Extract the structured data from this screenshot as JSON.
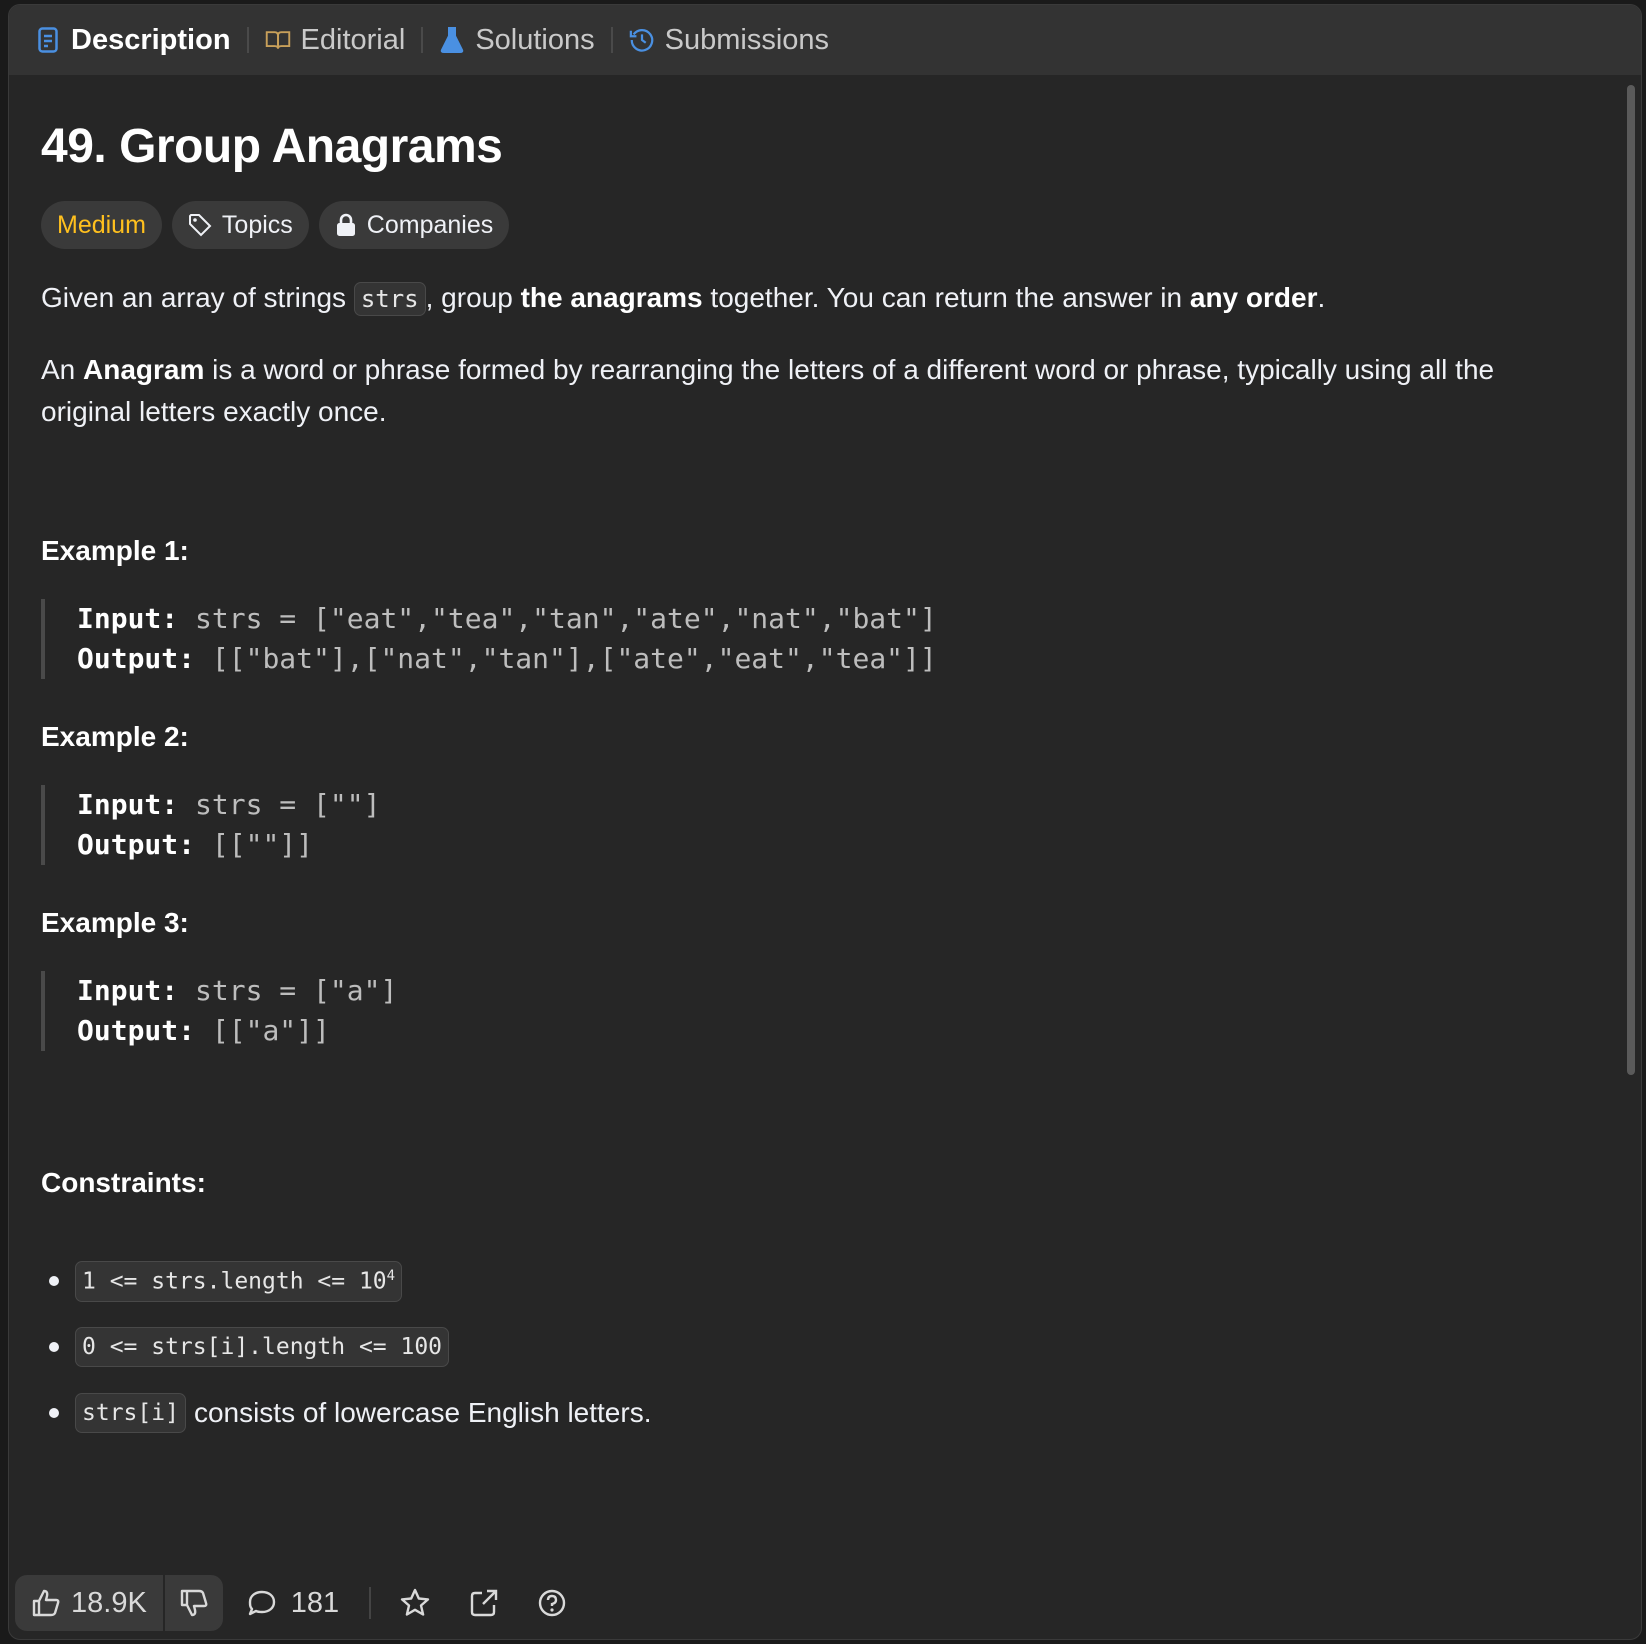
{
  "tabs": [
    {
      "label": "Description",
      "icon": "document-icon",
      "color": "#4a90e2"
    },
    {
      "label": "Editorial",
      "icon": "book-icon",
      "color": "#c8a05a"
    },
    {
      "label": "Solutions",
      "icon": "flask-icon",
      "color": "#4a90e2"
    },
    {
      "label": "Submissions",
      "icon": "history-icon",
      "color": "#4a90e2"
    }
  ],
  "problem": {
    "title": "49. Group Anagrams",
    "difficulty": "Medium",
    "topics_label": "Topics",
    "companies_label": "Companies",
    "p1": {
      "t1": "Given an array of strings ",
      "code": "strs",
      "t2": ", group ",
      "b1": "the anagrams",
      "t3": " together. You can return the answer in ",
      "b2": "any order",
      "t4": "."
    },
    "p2": {
      "t1": "An ",
      "b1": "Anagram",
      "t2": " is a word or phrase formed by rearranging the letters of a different word or phrase, typically using all the original letters exactly once."
    }
  },
  "examples": [
    {
      "title": "Example 1:",
      "input_label": "Input:",
      "input": " strs = [\"eat\",\"tea\",\"tan\",\"ate\",\"nat\",\"bat\"]",
      "output_label": "Output:",
      "output": " [[\"bat\"],[\"nat\",\"tan\"],[\"ate\",\"eat\",\"tea\"]]"
    },
    {
      "title": "Example 2:",
      "input_label": "Input:",
      "input": " strs = [\"\"]",
      "output_label": "Output:",
      "output": " [[\"\"]]"
    },
    {
      "title": "Example 3:",
      "input_label": "Input:",
      "input": " strs = [\"a\"]",
      "output_label": "Output:",
      "output": " [[\"a\"]]"
    }
  ],
  "constraints": {
    "title": "Constraints:",
    "c1_code": "1 <= strs.length <= 10",
    "c1_sup": "4",
    "c2_code": "0 <= strs[i].length <= 100",
    "c3_code": "strs[i]",
    "c3_text": "consists of lowercase English letters."
  },
  "footer": {
    "likes": "18.9K",
    "comments": "181"
  },
  "colors": {
    "medium": "#ffc01e",
    "bg": "#262626",
    "tabbar": "#333333"
  }
}
